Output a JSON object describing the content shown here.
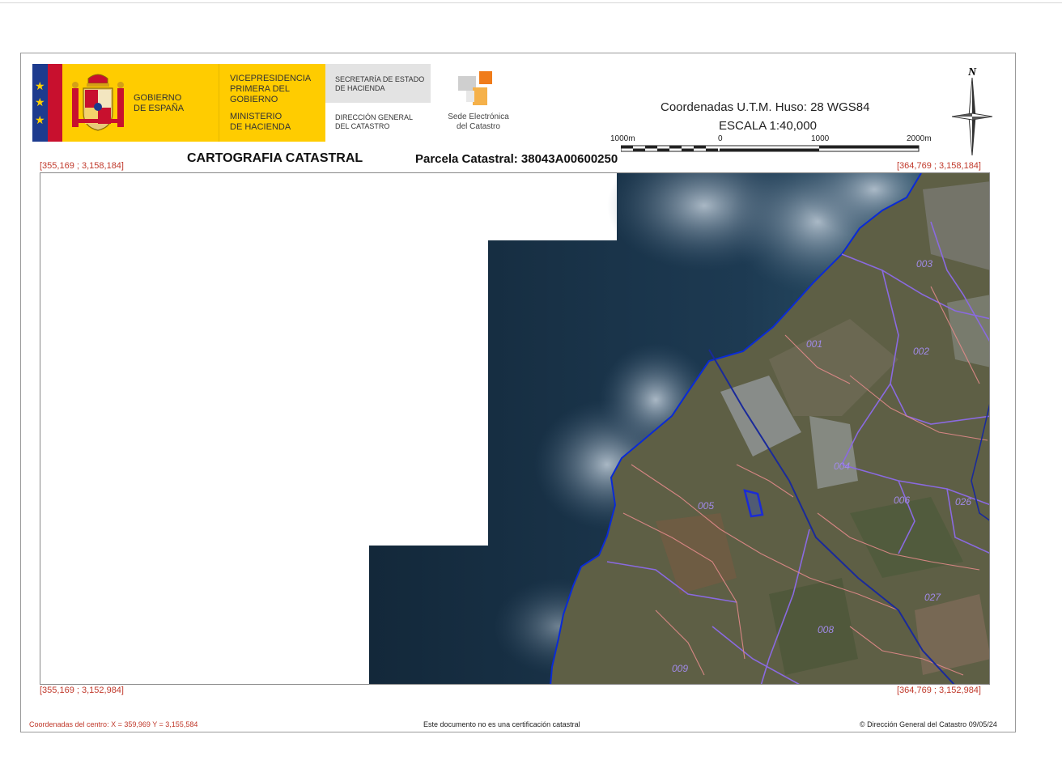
{
  "header": {
    "gobierno": [
      "GOBIERNO",
      "DE ESPAÑA"
    ],
    "vicepresidencia": [
      "VICEPRESIDENCIA",
      "PRIMERA DEL GOBIERNO"
    ],
    "ministerio": [
      "MINISTERIO",
      "DE HACIENDA"
    ],
    "secretaria": [
      "SECRETARÍA DE ESTADO",
      "DE HACIENDA"
    ],
    "direccion": [
      "DIRECCIÓN GENERAL",
      "DEL CATASTRO"
    ],
    "sede": [
      "Sede Electrónica",
      "del Catastro"
    ],
    "coordinates": "Coordenadas U.T.M. Huso: 28 WGS84",
    "scale": "ESCALA 1:40,000",
    "scale_labels": [
      "1000m",
      "0",
      "1000",
      "2000m"
    ],
    "north": "N"
  },
  "titles": {
    "cartografia": "CARTOGRAFIA CATASTRAL",
    "parcela": "Parcela Catastral: 38043A00600250"
  },
  "corners": {
    "top_left": "[355,169 ; 3,158,184]",
    "top_right": "[364,769 ; 3,158,184]",
    "bottom_left": "[355,169 ; 3,152,984]",
    "bottom_right": "[364,769 ; 3,152,984]"
  },
  "map": {
    "polygon_labels": [
      "003",
      "002",
      "001",
      "005",
      "004",
      "006",
      "026",
      "027",
      "008",
      "009"
    ],
    "colors": {
      "sea": "#1a2e3f",
      "coast": "#0a2bd6",
      "land": "#5f6046",
      "boundary": "#8a6ae0",
      "roads": "#e07a7a",
      "parcel": "#1a2bd6"
    }
  },
  "footer": {
    "center_coords": "Coordenadas del centro: X = 359,969 Y = 3,155,584",
    "disclaimer": "Este documento no es una certificación catastral",
    "copyright": "© Dirección General del Catastro 09/05/24"
  }
}
